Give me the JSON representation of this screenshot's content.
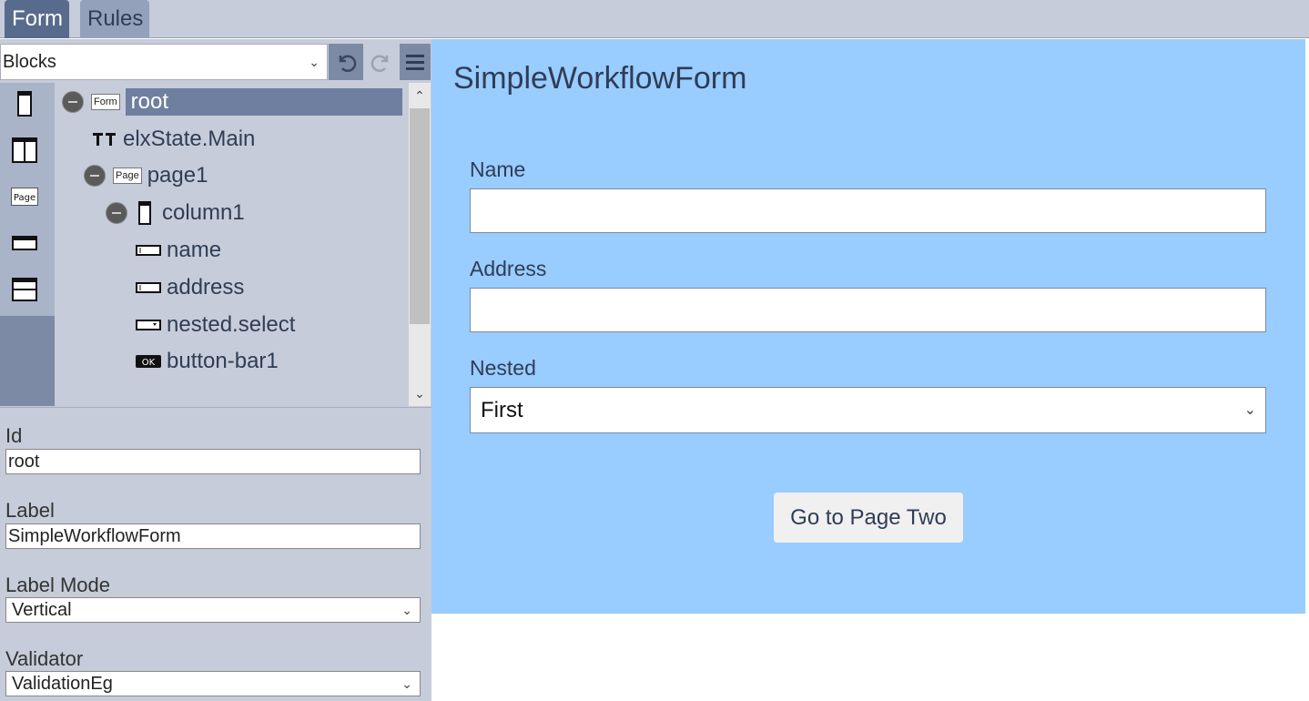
{
  "tabs": [
    {
      "label": "Form",
      "active": true
    },
    {
      "label": "Rules",
      "active": false
    }
  ],
  "toolbar": {
    "blocks_select": "Blocks",
    "undo_icon": "undo-icon",
    "redo_icon": "redo-icon",
    "menu_icon": "hamburger-menu-icon"
  },
  "palette": [
    "column-block-icon",
    "two-column-block-icon",
    "page-block-icon",
    "input-block-icon",
    "section-block-icon"
  ],
  "tree": {
    "items": [
      {
        "label": "root",
        "tag": "Form",
        "selected": true
      },
      {
        "label": "elxState.Main",
        "tag": ""
      },
      {
        "label": "page1",
        "tag": "Page"
      },
      {
        "label": "column1",
        "tag": ""
      },
      {
        "label": "name",
        "tag": ""
      },
      {
        "label": "address",
        "tag": ""
      },
      {
        "label": "nested.select",
        "tag": ""
      },
      {
        "label": "button-bar1",
        "tag": "OK"
      }
    ]
  },
  "props": {
    "id_label": "Id",
    "id_value": "root",
    "label_label": "Label",
    "label_value": "SimpleWorkflowForm",
    "label_mode_label": "Label Mode",
    "label_mode_value": "Vertical",
    "validator_label": "Validator",
    "validator_value": "ValidationEg"
  },
  "preview": {
    "title": "SimpleWorkflowForm",
    "name_label": "Name",
    "name_value": "",
    "address_label": "Address",
    "address_value": "",
    "nested_label": "Nested",
    "nested_value": "First",
    "button_label": "Go to Page Two",
    "background": "#99ccff"
  }
}
